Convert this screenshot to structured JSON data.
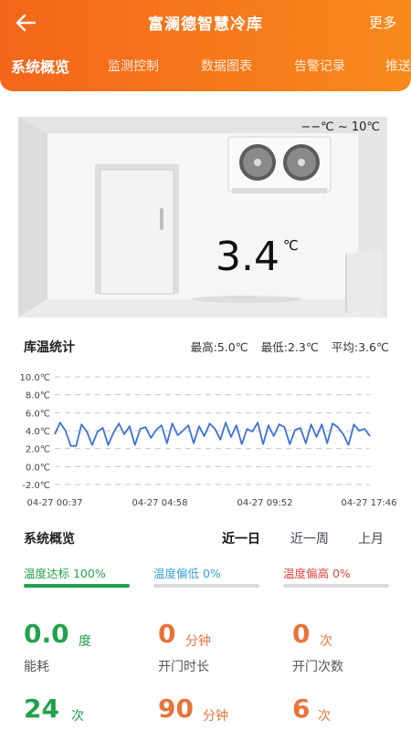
{
  "header": {
    "title": "富澜德智慧冷库",
    "more": "更多",
    "tabs": [
      "系统概览",
      "监测控制",
      "数据图表",
      "告警记录",
      "推送"
    ]
  },
  "room": {
    "range": "−−℃ ~ 10℃",
    "temperature": "3.4",
    "unit": "℃"
  },
  "stats": {
    "title": "库温统计",
    "max": "最高:5.0℃",
    "min": "最低:2.3℃",
    "avg": "平均:3.6℃"
  },
  "chart_data": {
    "type": "line",
    "y_ticks": [
      "10.0℃",
      "8.0℃",
      "6.0℃",
      "4.0℃",
      "2.0℃",
      "0.0℃",
      "-2.0℃"
    ],
    "ylim": [
      -2,
      10
    ],
    "x_ticks": [
      "04-27 00:37",
      "04-27 04:58",
      "04-27 09:52",
      "04-27 17:46"
    ],
    "grid": true,
    "series_color": "#3d72d8",
    "series": [
      {
        "values": [
          3.6,
          4.9,
          4.0,
          2.3,
          2.3,
          4.7,
          3.9,
          2.4,
          3.9,
          4.3,
          2.4,
          3.8,
          4.8,
          3.6,
          4.5,
          2.4,
          4.2,
          4.4,
          3.2,
          4.1,
          4.6,
          2.6,
          4.8,
          3.5,
          4.0,
          4.6,
          2.6,
          4.5,
          3.4,
          4.8,
          4.2,
          3.0,
          4.9,
          3.3,
          4.6,
          2.5,
          4.2,
          3.9,
          4.9,
          2.5,
          4.6,
          3.4,
          4.7,
          4.4,
          2.5,
          4.1,
          4.3,
          2.6,
          4.7,
          3.3,
          4.7,
          2.6,
          4.8,
          4.4,
          3.6,
          2.4,
          4.7,
          4.0,
          4.2,
          3.4
        ]
      }
    ]
  },
  "overview": {
    "title": "系统概览",
    "periods": [
      "近一日",
      "近一周",
      "上月"
    ],
    "active_period": "近一日",
    "pills": [
      {
        "label": "温度达标 100%",
        "color": "#21a24a"
      },
      {
        "label": "温度偏低 0%",
        "color": "#3aa0d8"
      },
      {
        "label": "温度偏高 0%",
        "color": "#e0443a"
      }
    ],
    "metrics": [
      {
        "value": "0.0",
        "unit": "度",
        "label": "能耗"
      },
      {
        "value": "0",
        "unit": "分钟",
        "label": "开门时长"
      },
      {
        "value": "0",
        "unit": "次",
        "label": "开门次数"
      },
      {
        "value": "24",
        "unit": "次",
        "label": ""
      },
      {
        "value": "90",
        "unit": "分钟",
        "label": ""
      },
      {
        "value": "6",
        "unit": "次",
        "label": ""
      }
    ]
  }
}
